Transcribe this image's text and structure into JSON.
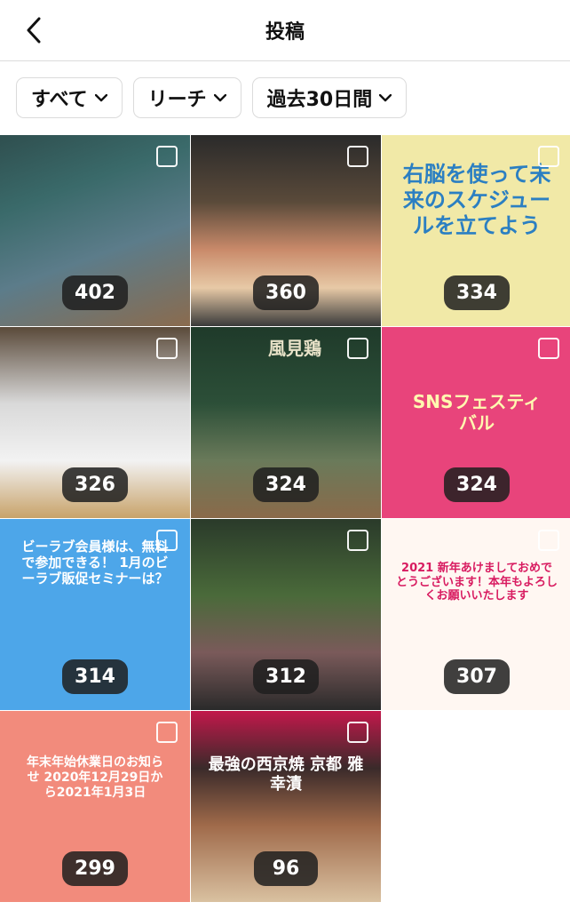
{
  "header": {
    "title": "投稿"
  },
  "filters": [
    {
      "label": "すべて"
    },
    {
      "label": "リーチ"
    },
    {
      "label": "過去30日間"
    }
  ],
  "posts": [
    {
      "count": "402"
    },
    {
      "count": "360"
    },
    {
      "count": "334",
      "overlay_text": "右脳を使って未来のスケジュールを立てよう"
    },
    {
      "count": "326"
    },
    {
      "count": "324",
      "overlay_text": "風見鶏"
    },
    {
      "count": "324",
      "overlay_text": "SNSフェスティバル"
    },
    {
      "count": "314",
      "overlay_text": "ビーラブ会員様は、無料で参加できる！ 1月のビーラブ販促セミナーは？"
    },
    {
      "count": "312"
    },
    {
      "count": "307",
      "overlay_text": "2021 新年あけましておめでとうございます！本年もよろしくお願いいたします"
    },
    {
      "count": "299",
      "overlay_text": "年末年始休業日のお知らせ 2020年12月29日から2021年1月3日"
    },
    {
      "count": "96",
      "overlay_text": "最強の西京焼 京都 雅幸漬"
    }
  ],
  "colors": {
    "accent": "#e8447b",
    "chip_border": "#dbdbdb",
    "count_bg": "#1e1e1e"
  }
}
